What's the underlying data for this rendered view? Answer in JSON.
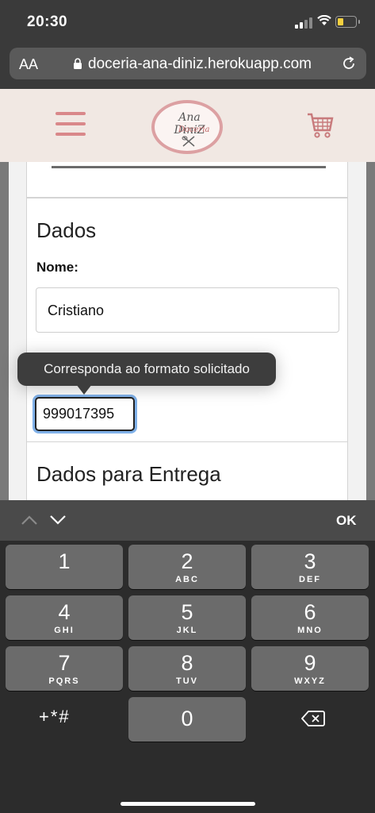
{
  "status_bar": {
    "time": "20:30"
  },
  "browser": {
    "text_size_label": "AA",
    "url": "doceria-ana-diniz.herokuapp.com"
  },
  "site": {
    "logo_line1": "Ana DiniZ",
    "logo_line2": "Doceria"
  },
  "form": {
    "section_title": "Dados",
    "name_label": "Nome:",
    "name_value": "Cristiano",
    "phone_value": "999017395",
    "validation_tooltip": "Corresponda ao formato solicitado",
    "delivery_title": "Dados para Entrega"
  },
  "keyboard": {
    "done_label": "OK",
    "keys": [
      {
        "digit": "1",
        "letters": ""
      },
      {
        "digit": "2",
        "letters": "ABC"
      },
      {
        "digit": "3",
        "letters": "DEF"
      },
      {
        "digit": "4",
        "letters": "GHI"
      },
      {
        "digit": "5",
        "letters": "JKL"
      },
      {
        "digit": "6",
        "letters": "MNO"
      },
      {
        "digit": "7",
        "letters": "PQRS"
      },
      {
        "digit": "8",
        "letters": "TUV"
      },
      {
        "digit": "9",
        "letters": "WXYZ"
      },
      {
        "digit": "0",
        "letters": ""
      }
    ],
    "symbols_label": "+*#"
  }
}
